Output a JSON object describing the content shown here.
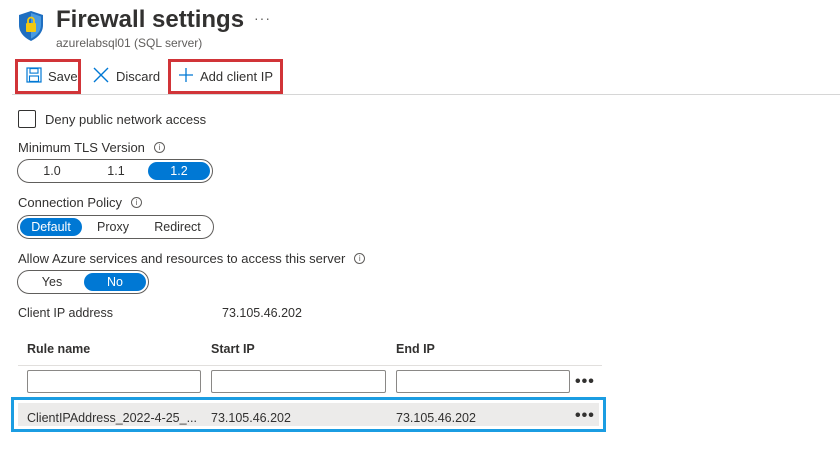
{
  "header": {
    "title": "Firewall settings",
    "subtitle": "azurelabsql01 (SQL server)",
    "more": "···"
  },
  "toolbar": {
    "save_label": "Save",
    "discard_label": "Discard",
    "add_client_ip_label": "Add client IP"
  },
  "deny_public": {
    "label": "Deny public network access",
    "checked": false
  },
  "tls": {
    "label": "Minimum TLS Version",
    "options": [
      "1.0",
      "1.1",
      "1.2"
    ],
    "selected": "1.2"
  },
  "connection_policy": {
    "label": "Connection Policy",
    "options": [
      "Default",
      "Proxy",
      "Redirect"
    ],
    "selected": "Default"
  },
  "allow_azure": {
    "label": "Allow Azure services and resources to access this server",
    "options": [
      "Yes",
      "No"
    ],
    "selected": "No"
  },
  "client_ip": {
    "label": "Client IP address",
    "value": "73.105.46.202"
  },
  "rules_table": {
    "columns": [
      "Rule name",
      "Start IP",
      "End IP"
    ],
    "new_rule": {
      "rule_name": "",
      "start_ip": "",
      "end_ip": ""
    },
    "rows": [
      {
        "rule_name": "ClientIPAddress_2022-4-25_...",
        "start_ip": "73.105.46.202",
        "end_ip": "73.105.46.202"
      }
    ],
    "row_more": "•••"
  },
  "colors": {
    "accent": "#0078d4",
    "highlight_red": "#d13438",
    "highlight_blue": "#1b9de2"
  },
  "icons": {
    "header": "shield-lock-icon",
    "save": "floppy-disk-icon",
    "discard": "close-icon",
    "add": "plus-icon",
    "info": "info-icon"
  }
}
